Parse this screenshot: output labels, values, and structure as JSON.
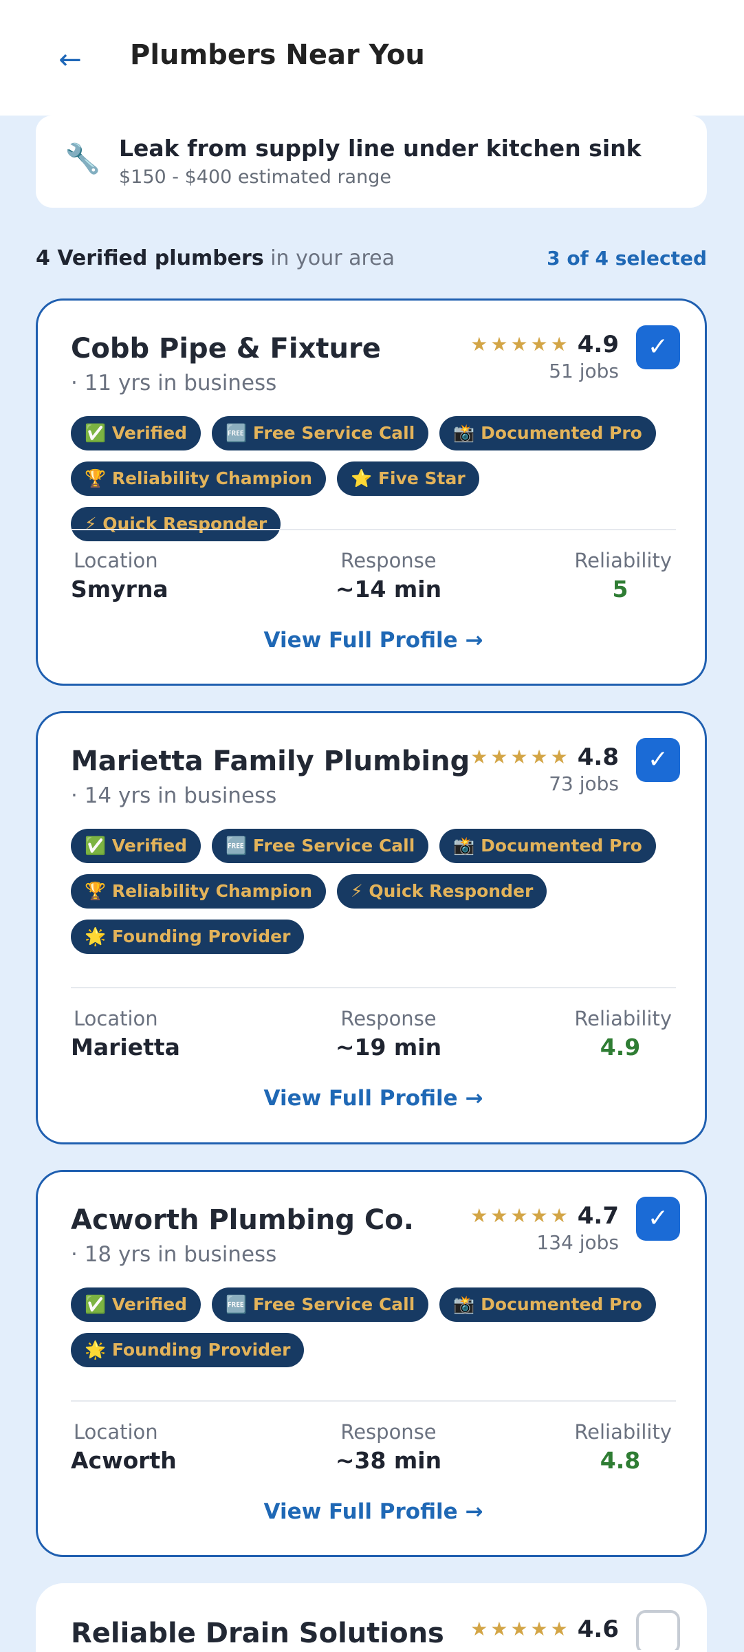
{
  "header": {
    "back_icon": "←",
    "title": "Plumbers Near You"
  },
  "job": {
    "icon": "🔧",
    "title": "Leak from supply line under kitchen sink",
    "range": "$150 - $400 estimated range"
  },
  "summary": {
    "count_label": "4 Verified plumbers",
    "area_label": " in your area",
    "selected_label": "3 of 4 selected"
  },
  "labels": {
    "location": "Location",
    "response": "Response",
    "reliability": "Reliability",
    "view_profile": "View Full Profile →",
    "stars": "★★★★★",
    "check": "✓"
  },
  "providers": [
    {
      "name": "Cobb Pipe & Fixture",
      "years": "· 11 yrs in business",
      "rating": "4.9",
      "jobs": "51 jobs",
      "selected": true,
      "badges": [
        "✅ Verified",
        "🆓 Free Service Call",
        "📸 Documented Pro",
        "🏆 Reliability Champion",
        "⭐ Five Star",
        "⚡ Quick Responder"
      ],
      "location": "Smyrna",
      "response": "~14 min",
      "reliability": "5"
    },
    {
      "name": "Marietta Family Plumbing",
      "years": "· 14 yrs in business",
      "rating": "4.8",
      "jobs": "73 jobs",
      "selected": true,
      "badges": [
        "✅ Verified",
        "🆓 Free Service Call",
        "📸 Documented Pro",
        "🏆 Reliability Champion",
        "⚡ Quick Responder",
        "🌟 Founding Provider"
      ],
      "location": "Marietta",
      "response": "~19 min",
      "reliability": "4.9"
    },
    {
      "name": "Acworth Plumbing Co.",
      "years": "· 18 yrs in business",
      "rating": "4.7",
      "jobs": "134 jobs",
      "selected": true,
      "badges": [
        "✅ Verified",
        "🆓 Free Service Call",
        "📸 Documented Pro",
        "🌟 Founding Provider"
      ],
      "location": "Acworth",
      "response": "~38 min",
      "reliability": "4.8"
    },
    {
      "name": "Reliable Drain Solutions",
      "rating": "4.6",
      "selected": false
    }
  ]
}
